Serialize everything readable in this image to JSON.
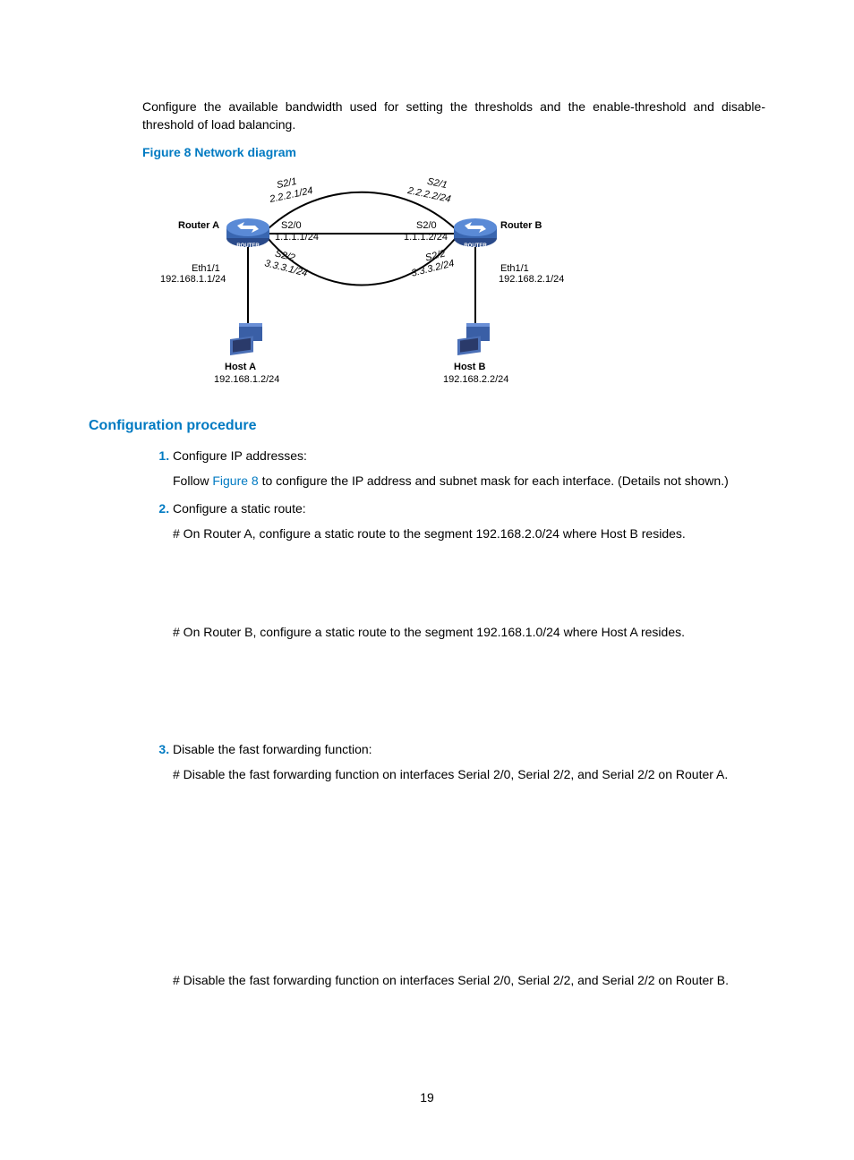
{
  "intro": "Configure the available bandwidth used for setting the thresholds and the enable-threshold and disable-threshold of load balancing.",
  "fig_caption": "Figure 8 Network diagram",
  "section_heading": "Configuration procedure",
  "step1_title": "Configure IP addresses:",
  "step1_body_a": "Follow ",
  "step1_link": "Figure 8",
  "step1_body_b": " to configure the IP address and subnet mask for each interface. (Details not shown.)",
  "step2_title": "Configure a static route:",
  "step2_a": "# On Router A, configure a static route to the segment 192.168.2.0/24 where Host B resides.",
  "step2_b": "# On Router B, configure a static route to the segment 192.168.1.0/24 where Host A resides.",
  "step3_title": "Disable the fast forwarding function:",
  "step3_a": "# Disable the fast forwarding function on interfaces Serial 2/0, Serial 2/2, and Serial 2/2 on Router A.",
  "step3_b": "# Disable the fast forwarding function on interfaces Serial 2/0, Serial 2/2, and Serial 2/2 on Router B.",
  "page_num": "19",
  "diagram": {
    "routerA": "Router A",
    "routerB": "Router B",
    "hostA": "Host A",
    "hostA_ip": "192.168.1.2/24",
    "hostB": "Host B",
    "hostB_ip": "192.168.2.2/24",
    "ethA": "Eth1/1",
    "ethA_ip": "192.168.1.1/24",
    "ethB": "Eth1/1",
    "ethB_ip": "192.168.2.1/24",
    "s20a": "S2/0",
    "s20a_ip": "1.1.1.1/24",
    "s20b": "S2/0",
    "s20b_ip": "1.1.1.2/24",
    "s21a": "S2/1",
    "s21a_ip": "2.2.2.1/24",
    "s21b": "S2/1",
    "s21b_ip": "2.2.2.2/24",
    "s22a": "S2/2",
    "s22a_ip": "3.3.3.1/24",
    "s22b": "S2/2",
    "s22b_ip": "3.3.3.2/24"
  }
}
